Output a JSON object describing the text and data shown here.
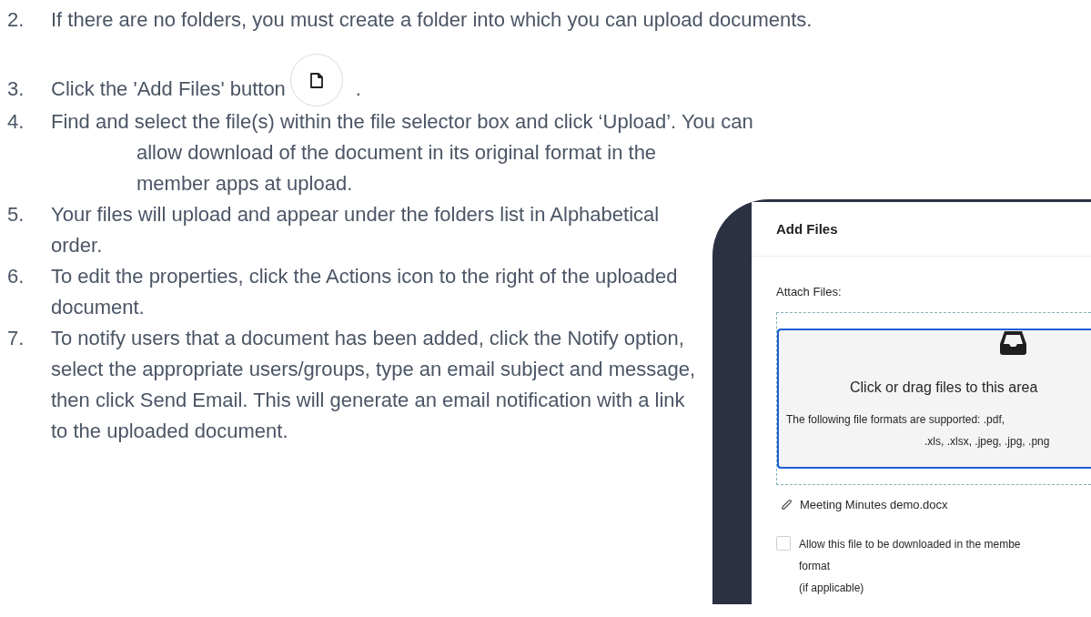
{
  "steps": [
    {
      "number": "2.",
      "kind": "plain",
      "text": "If there are no folders, you must create a folder into which you can upload documents."
    },
    {
      "number": "3.",
      "kind": "with-button",
      "text": "Click the 'Add Files' button",
      "trailing": "."
    },
    {
      "number": "4.",
      "kind": "with-note",
      "text": "Find and select the file(s) within the file selector box and click ‘Upload’. You can",
      "note": "allow download of the document in its original format in the member apps at upload."
    },
    {
      "number": "5.",
      "kind": "plain",
      "text": "Your files will upload and appear under the folders list in Alphabetical order."
    },
    {
      "number": "6.",
      "kind": "plain",
      "text": "To edit the properties, click the Actions icon to the right of the uploaded document."
    },
    {
      "number": "7.",
      "kind": "plain",
      "text": "To notify users that a document has been added, click the Notify option, select the appropriate users/groups, type an email subject and message, then click Send Email. This will generate an email notification with a link to the uploaded document."
    }
  ],
  "dialog": {
    "title": "Add Files",
    "field_label": "Attach Files:",
    "dropzone": {
      "title": "Click or drag files to this area",
      "formats": [
        "The following file formats are supported: .pdf,",
        ".xls, .xlsx, .jpeg, .jpg, .png"
      ]
    },
    "attachment": "Meeting Minutes demo.docx",
    "checkbox": {
      "checked": false,
      "lines": [
        "Allow this file to be downloaded in the membe",
        "format",
        "(if applicable)"
      ]
    }
  }
}
